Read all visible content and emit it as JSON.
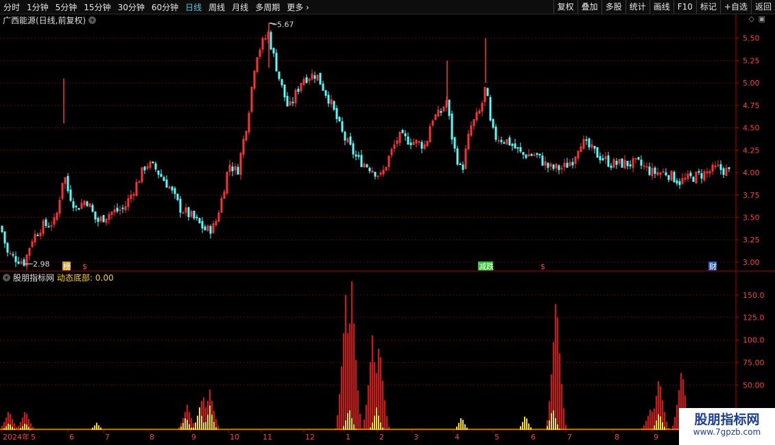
{
  "toolbar": {
    "periods": [
      "分时",
      "1分钟",
      "5分钟",
      "15分钟",
      "30分钟",
      "60分钟",
      "日线",
      "周线",
      "月线",
      "多周期",
      "更多"
    ],
    "active_period": "日线",
    "tools": [
      "复权",
      "叠加",
      "多股",
      "统计",
      "画线",
      "F10",
      "标记",
      "+自选",
      "返回"
    ]
  },
  "main_panel": {
    "title": "广西能源(日线,前复权)",
    "high_label": "5.67",
    "low_label": "2.98",
    "markers": [
      "榜",
      "$",
      "减跌",
      "$",
      "财"
    ]
  },
  "indicator_panel": {
    "name": "股朋指标网",
    "line_label": "动态底部: 0.00"
  },
  "watermark": {
    "line1": "股朋指标网",
    "line2": "www.7gpzb.com"
  },
  "colors": {
    "up": "#ff3232",
    "down": "#54ffff",
    "grid": "#6a0000",
    "axis": "#b00000",
    "bar_red": "#e01010",
    "bar_yellow": "#ffe000"
  },
  "chart_data": [
    {
      "type": "candlestick",
      "title": "广西能源(日线,前复权)",
      "ylim": [
        2.9,
        5.62
      ],
      "yticks": [
        "5.50",
        "5.25",
        "5.00",
        "4.75",
        "4.50",
        "4.25",
        "4.00",
        "3.75",
        "3.50",
        "3.25",
        "3.00"
      ],
      "high": 5.67,
      "low": 2.98,
      "x_months": [
        "2024年",
        "5",
        "6",
        "7",
        "8",
        "9",
        "10",
        "11",
        "12",
        "1",
        "2",
        "3",
        "4",
        "5",
        "6",
        "7",
        "8",
        "9"
      ],
      "close_path": [
        [
          0,
          3.4
        ],
        [
          10,
          3.1
        ],
        [
          20,
          3.05
        ],
        [
          35,
          3.0
        ],
        [
          45,
          3.25
        ],
        [
          60,
          3.4
        ],
        [
          80,
          3.45
        ],
        [
          92,
          4.0
        ],
        [
          98,
          3.8
        ],
        [
          110,
          3.6
        ],
        [
          125,
          3.7
        ],
        [
          140,
          3.45
        ],
        [
          160,
          3.55
        ],
        [
          180,
          3.6
        ],
        [
          200,
          3.9
        ],
        [
          212,
          4.1
        ],
        [
          225,
          4.05
        ],
        [
          245,
          3.85
        ],
        [
          262,
          3.6
        ],
        [
          280,
          3.5
        ],
        [
          300,
          3.35
        ],
        [
          312,
          3.4
        ],
        [
          322,
          3.7
        ],
        [
          333,
          4.1
        ],
        [
          345,
          4.0
        ],
        [
          360,
          4.6
        ],
        [
          372,
          5.3
        ],
        [
          382,
          5.45
        ],
        [
          390,
          5.55
        ],
        [
          398,
          5.3
        ],
        [
          408,
          5.0
        ],
        [
          420,
          4.7
        ],
        [
          440,
          5.05
        ],
        [
          460,
          5.1
        ],
        [
          480,
          4.8
        ],
        [
          500,
          4.4
        ],
        [
          520,
          4.15
        ],
        [
          540,
          4.05
        ],
        [
          555,
          3.95
        ],
        [
          565,
          4.15
        ],
        [
          580,
          4.4
        ],
        [
          600,
          4.35
        ],
        [
          620,
          4.3
        ],
        [
          628,
          4.6
        ],
        [
          640,
          4.65
        ],
        [
          650,
          4.8
        ],
        [
          660,
          4.3
        ],
        [
          672,
          4.0
        ],
        [
          685,
          4.5
        ],
        [
          700,
          4.7
        ],
        [
          708,
          5.0
        ],
        [
          712,
          4.6
        ],
        [
          720,
          4.4
        ],
        [
          740,
          4.35
        ],
        [
          760,
          4.2
        ],
        [
          780,
          4.2
        ],
        [
          800,
          4.05
        ],
        [
          820,
          4.05
        ],
        [
          835,
          4.15
        ],
        [
          845,
          4.35
        ],
        [
          855,
          4.3
        ],
        [
          870,
          4.2
        ],
        [
          890,
          4.1
        ],
        [
          910,
          4.1
        ],
        [
          930,
          4.1
        ],
        [
          950,
          4.0
        ],
        [
          970,
          4.0
        ],
        [
          990,
          3.9
        ],
        [
          1010,
          3.95
        ],
        [
          1030,
          4.0
        ],
        [
          1045,
          4.05
        ],
        [
          1065,
          4.0
        ]
      ]
    },
    {
      "type": "bar",
      "title": "动态底部",
      "ylim": [
        0,
        175
      ],
      "yticks": [
        "150.0",
        "125.0",
        "100.0",
        "75.00",
        "50.00"
      ],
      "value": 0.0,
      "red_peaks": [
        [
          12,
          22
        ],
        [
          36,
          22
        ],
        [
          272,
          28
        ],
        [
          295,
          40
        ],
        [
          305,
          45
        ],
        [
          503,
          150
        ],
        [
          512,
          165
        ],
        [
          542,
          105
        ],
        [
          552,
          100
        ],
        [
          810,
          155
        ],
        [
          948,
          25
        ],
        [
          960,
          60
        ],
        [
          993,
          70
        ]
      ],
      "yellow_peaks": [
        [
          12,
          8
        ],
        [
          36,
          8
        ],
        [
          140,
          8
        ],
        [
          270,
          15
        ],
        [
          290,
          25
        ],
        [
          305,
          27
        ],
        [
          508,
          25
        ],
        [
          548,
          25
        ],
        [
          672,
          15
        ],
        [
          765,
          17
        ],
        [
          805,
          25
        ],
        [
          960,
          20
        ]
      ]
    }
  ]
}
